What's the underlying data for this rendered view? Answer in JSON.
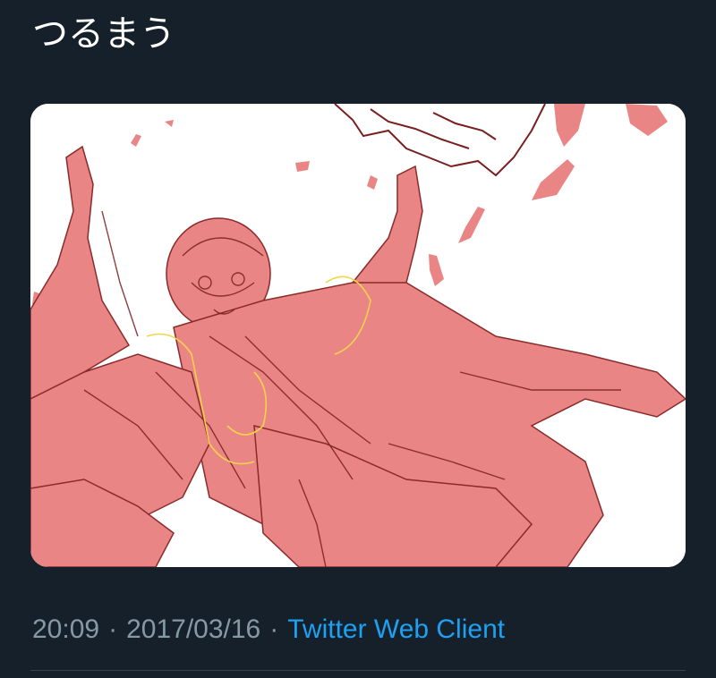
{
  "tweet": {
    "text": "つるまう",
    "time": "20:09",
    "separator": "·",
    "date": "2017/03/16",
    "source": "Twitter Web Client"
  },
  "media": {
    "kind": "illustration-sketch",
    "colors": {
      "background": "#ffffff",
      "fill": "#ea8585",
      "line": "#7a1f1f",
      "glow": "#f5d34a"
    }
  },
  "colors": {
    "page_background": "#15202b",
    "text_primary": "#ffffff",
    "text_secondary": "#8899a6",
    "link": "#1da1f2",
    "divider": "#38444d"
  }
}
